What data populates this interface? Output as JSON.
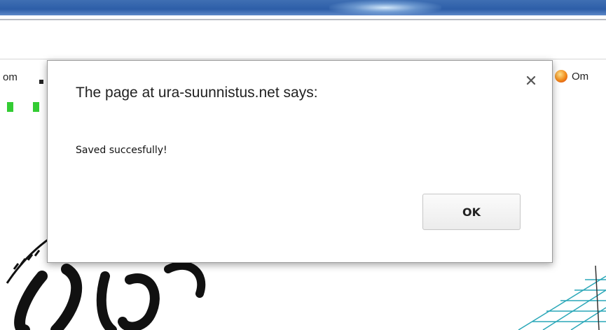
{
  "browser": {
    "bookmark_left_text": "om",
    "bookmark_right_text": "Om",
    "bookmark_right_icon": "orange-favicon-icon"
  },
  "background": {
    "logo_text": "Ura",
    "logo_icon": "ura-logo-icon",
    "map_icon": "orienteering-map-icon"
  },
  "dialog": {
    "title": "The page at ura-suunnistus.net says:",
    "message": "Saved succesfully!",
    "ok_label": "OK",
    "close_icon": "close-icon"
  },
  "colors": {
    "title_bar": "#2d5ea8",
    "green_marks": "#33cc33",
    "dialog_border": "#9a9a9a"
  }
}
